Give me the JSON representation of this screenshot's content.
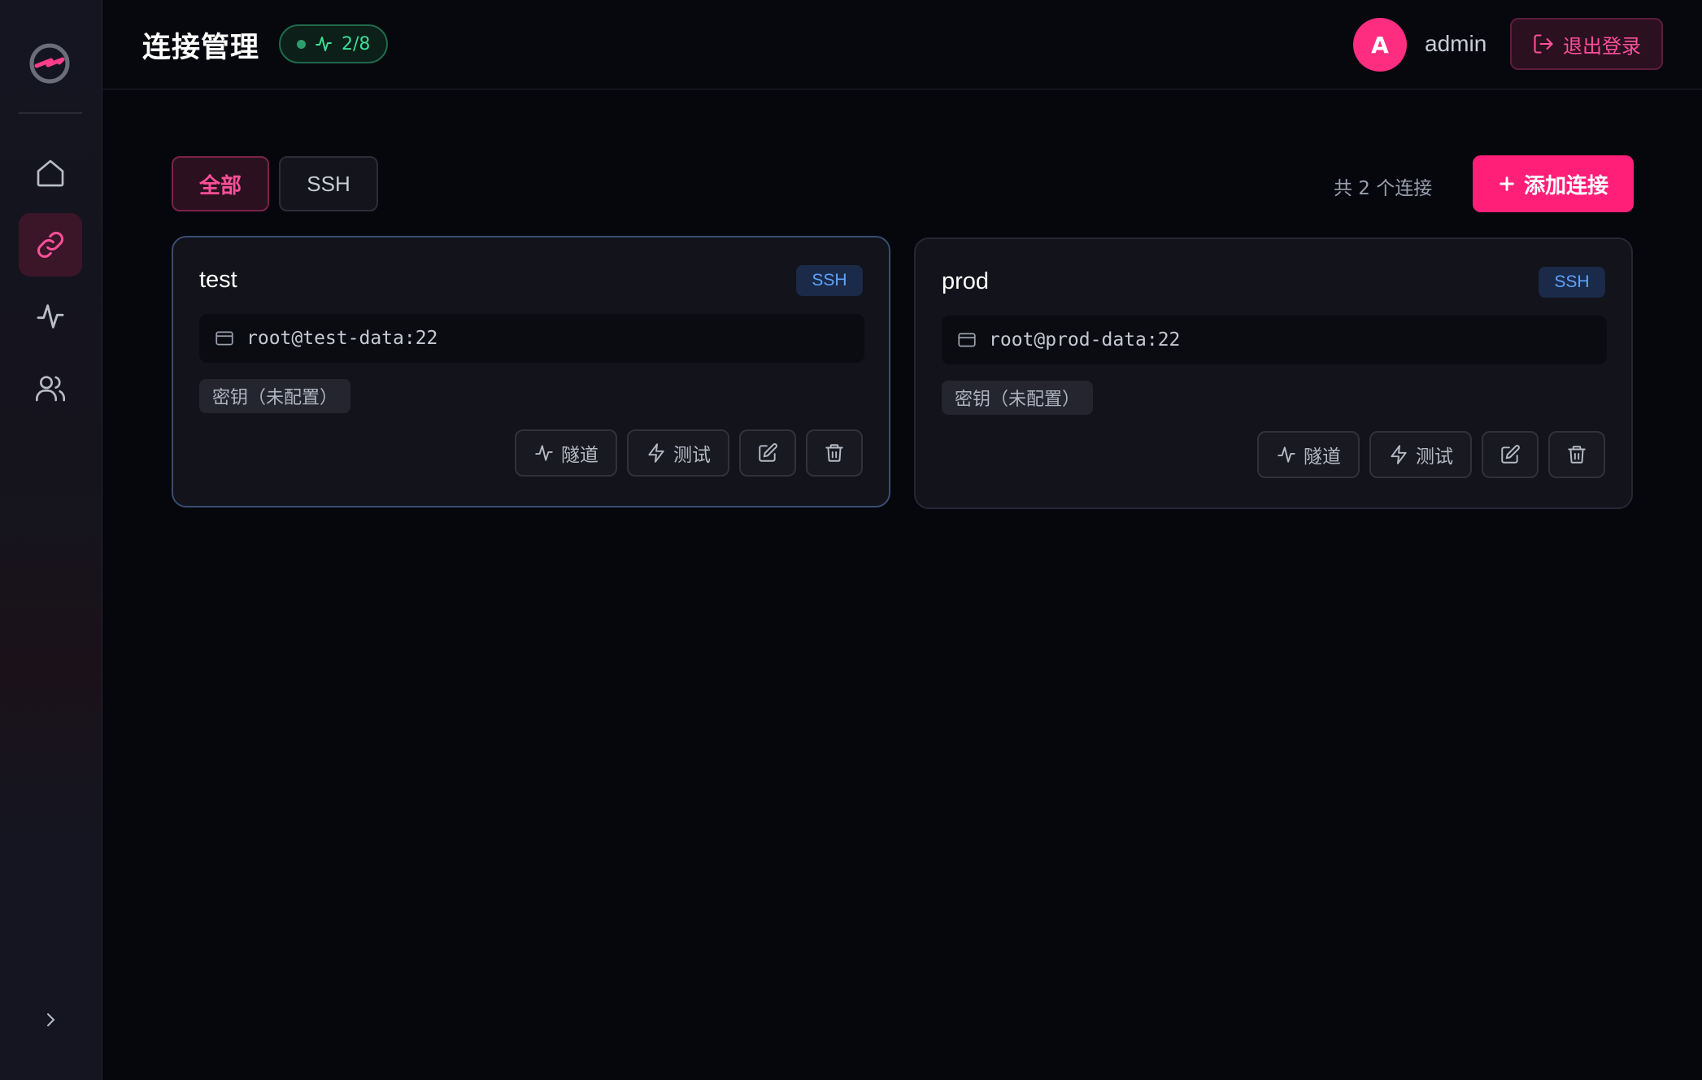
{
  "header": {
    "title": "连接管理",
    "status": "2/8",
    "user": {
      "initial": "A",
      "name": "admin"
    },
    "logout_label": "退出登录"
  },
  "sidebar": {
    "items": [
      {
        "name": "home",
        "icon": "home-icon"
      },
      {
        "name": "connections",
        "icon": "link-icon",
        "active": true
      },
      {
        "name": "monitor",
        "icon": "activity-icon"
      },
      {
        "name": "users",
        "icon": "users-icon"
      }
    ]
  },
  "filters": {
    "tabs": [
      {
        "label": "全部",
        "active": true
      },
      {
        "label": "SSH",
        "active": false
      }
    ],
    "count_text": "共 2 个连接",
    "add_label": "添加连接"
  },
  "connections": [
    {
      "name": "test",
      "type": "SSH",
      "address": "root@test-data:22",
      "auth": "密钥（未配置）",
      "tunnel_label": "隧道",
      "test_label": "测试"
    },
    {
      "name": "prod",
      "type": "SSH",
      "address": "root@prod-data:22",
      "auth": "密钥（未配置）",
      "tunnel_label": "隧道",
      "test_label": "测试"
    }
  ],
  "colors": {
    "accent": "#ff1f78",
    "success": "#3ddc97",
    "ssh_badge": "#5ea4ff",
    "background": "#06070d"
  }
}
